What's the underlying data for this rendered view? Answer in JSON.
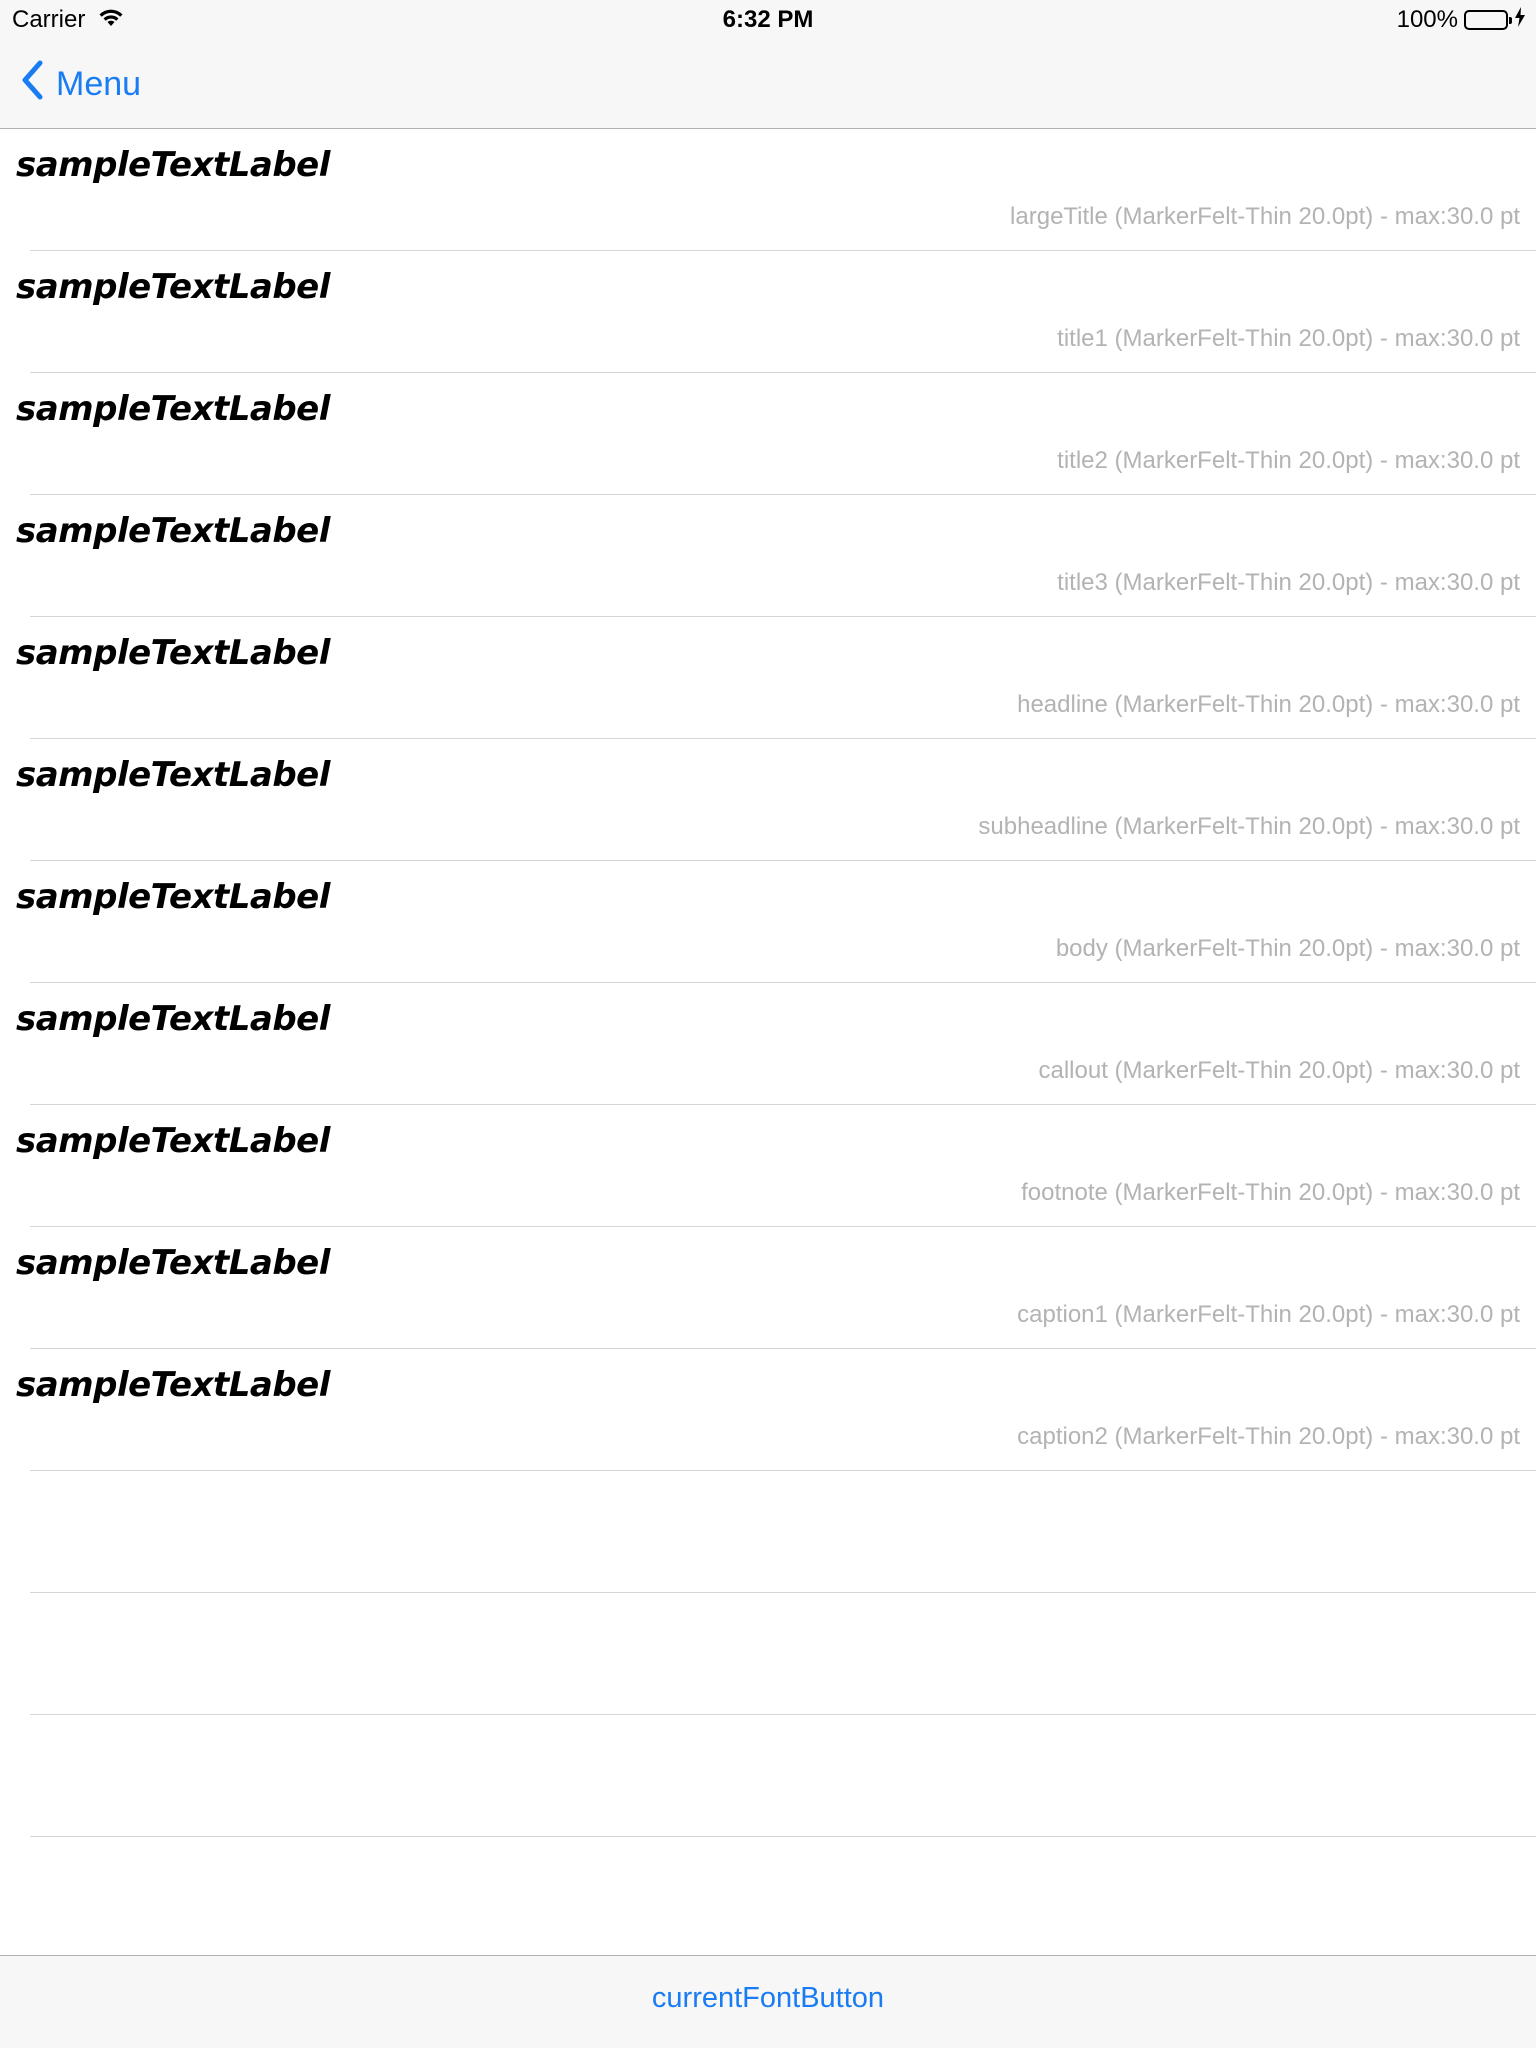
{
  "status": {
    "carrier": "Carrier",
    "time": "6:32 PM",
    "battery": "100%"
  },
  "nav": {
    "back_label": "Menu"
  },
  "rows": [
    {
      "sample": "sampleTextLabel",
      "detail": "largeTitle  (MarkerFelt-Thin 20.0pt) - max:30.0 pt"
    },
    {
      "sample": "sampleTextLabel",
      "detail": "title1  (MarkerFelt-Thin 20.0pt) - max:30.0 pt"
    },
    {
      "sample": "sampleTextLabel",
      "detail": "title2  (MarkerFelt-Thin 20.0pt) - max:30.0 pt"
    },
    {
      "sample": "sampleTextLabel",
      "detail": "title3  (MarkerFelt-Thin 20.0pt) - max:30.0 pt"
    },
    {
      "sample": "sampleTextLabel",
      "detail": "headline  (MarkerFelt-Thin 20.0pt) - max:30.0 pt"
    },
    {
      "sample": "sampleTextLabel",
      "detail": "subheadline  (MarkerFelt-Thin 20.0pt) - max:30.0 pt"
    },
    {
      "sample": "sampleTextLabel",
      "detail": "body  (MarkerFelt-Thin 20.0pt) - max:30.0 pt"
    },
    {
      "sample": "sampleTextLabel",
      "detail": "callout  (MarkerFelt-Thin 20.0pt) - max:30.0 pt"
    },
    {
      "sample": "sampleTextLabel",
      "detail": "footnote  (MarkerFelt-Thin 20.0pt) - max:30.0 pt"
    },
    {
      "sample": "sampleTextLabel",
      "detail": "caption1  (MarkerFelt-Thin 20.0pt) - max:30.0 pt"
    },
    {
      "sample": "sampleTextLabel",
      "detail": "caption2  (MarkerFelt-Thin 20.0pt) - max:30.0 pt"
    },
    {
      "sample": "",
      "detail": ""
    },
    {
      "sample": "",
      "detail": ""
    },
    {
      "sample": "",
      "detail": ""
    }
  ],
  "toolbar": {
    "font_button_label": "currentFontButton"
  },
  "colors": {
    "tint": "#1a7cf2",
    "battery": "#4cd964"
  },
  "icons": [
    "wifi-icon",
    "battery-icon",
    "charging-bolt-icon",
    "chevron-left-icon"
  ]
}
